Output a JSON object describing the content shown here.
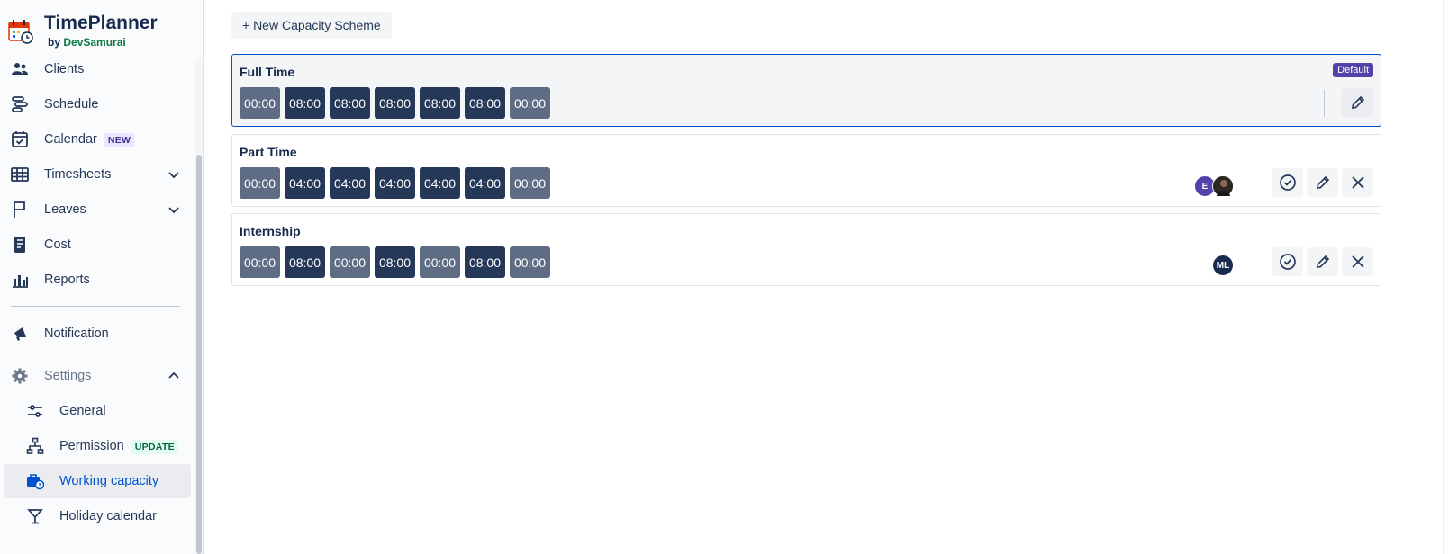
{
  "app": {
    "title": "TimePlanner",
    "by_prefix": "by",
    "by_name": "DevSamurai"
  },
  "sidebar": {
    "items": [
      {
        "label": "Clients"
      },
      {
        "label": "Schedule"
      },
      {
        "label": "Calendar",
        "badge": "NEW"
      },
      {
        "label": "Timesheets"
      },
      {
        "label": "Leaves"
      },
      {
        "label": "Cost"
      },
      {
        "label": "Reports"
      },
      {
        "label": "Notification"
      },
      {
        "label": "Settings"
      },
      {
        "label": "General"
      },
      {
        "label": "Permission",
        "badge": "UPDATE"
      },
      {
        "label": "Working capacity"
      },
      {
        "label": "Holiday calendar"
      }
    ]
  },
  "main": {
    "new_button_label": "+ New Capacity Scheme",
    "schemes": [
      {
        "name": "Full Time",
        "badge": "Default",
        "days": [
          "00:00",
          "08:00",
          "08:00",
          "08:00",
          "08:00",
          "08:00",
          "00:00"
        ]
      },
      {
        "name": "Part Time",
        "days": [
          "00:00",
          "04:00",
          "04:00",
          "04:00",
          "04:00",
          "04:00",
          "00:00"
        ],
        "avatars": [
          "E",
          ""
        ]
      },
      {
        "name": "Internship",
        "days": [
          "00:00",
          "08:00",
          "00:00",
          "08:00",
          "00:00",
          "08:00",
          "00:00"
        ],
        "avatars": [
          "ML"
        ]
      }
    ]
  },
  "colors": {
    "accent": "#0052cc",
    "day_on": "#253858",
    "day_off": "#5e6c84",
    "default_badge": "#5243aa"
  }
}
